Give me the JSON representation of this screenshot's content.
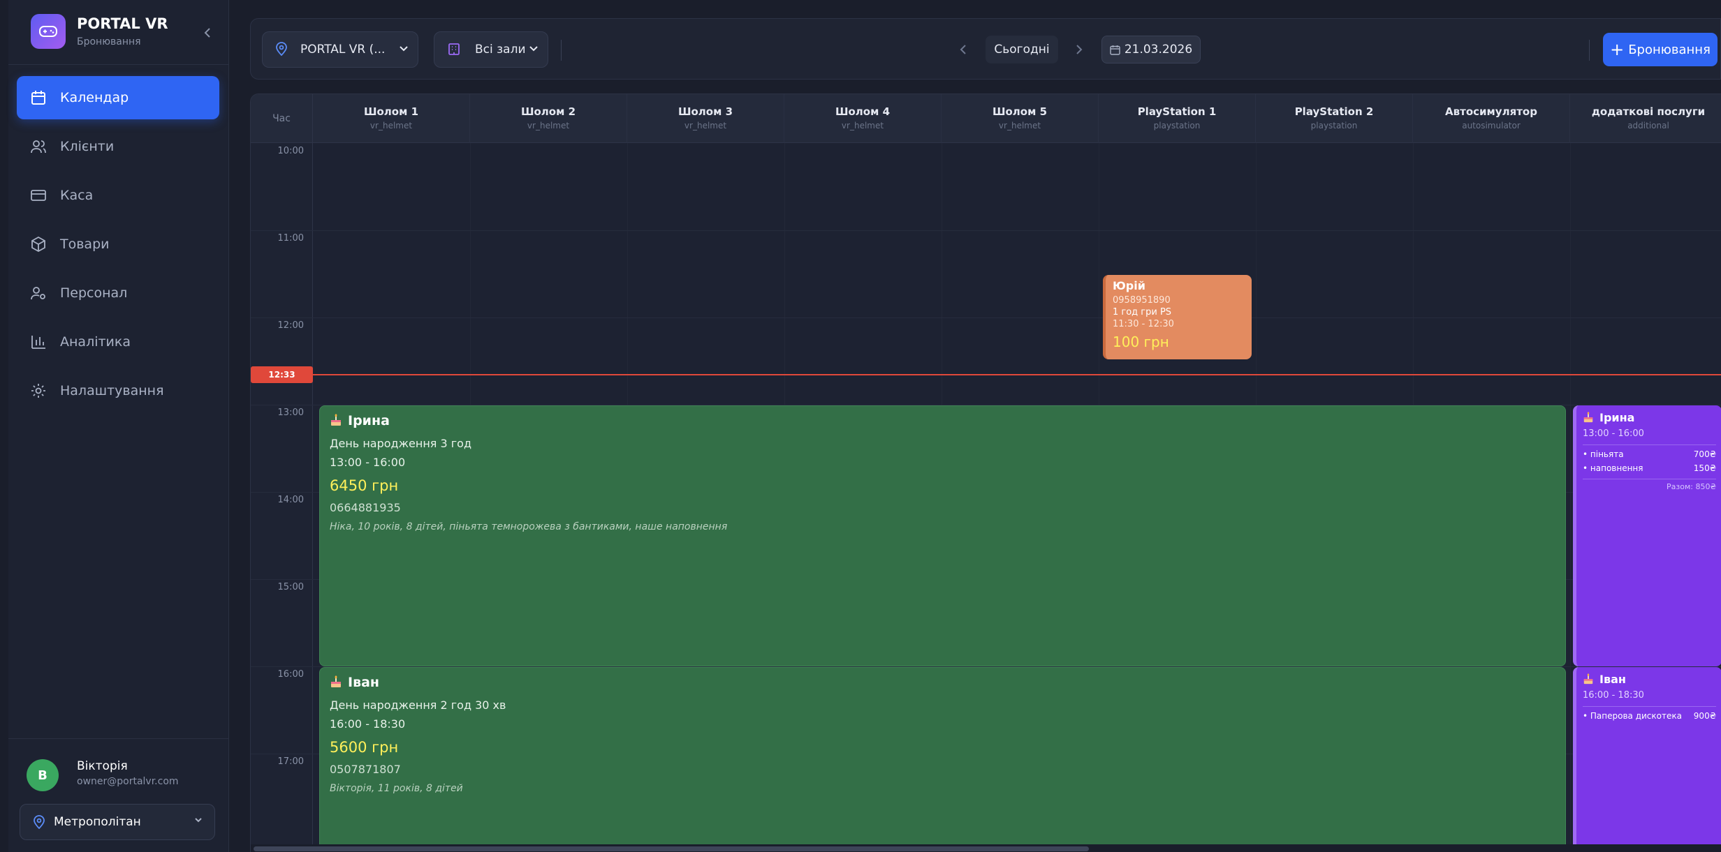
{
  "brand": {
    "title": "PORTAL VR",
    "subtitle": "Бронювання"
  },
  "nav": [
    {
      "label": "Календар",
      "icon": "calendar-icon",
      "active": true
    },
    {
      "label": "Клієнти",
      "icon": "users-icon"
    },
    {
      "label": "Каса",
      "icon": "credit-card-icon"
    },
    {
      "label": "Товари",
      "icon": "box-icon"
    },
    {
      "label": "Персонал",
      "icon": "user-cog-icon"
    },
    {
      "label": "Аналітика",
      "icon": "bar-chart-icon"
    },
    {
      "label": "Налаштування",
      "icon": "gear-icon"
    }
  ],
  "user": {
    "initial": "В",
    "name": "Вікторія",
    "email": "owner@portalvr.com"
  },
  "location_selector": {
    "value": "Метрополітан"
  },
  "toolbar": {
    "venue": "PORTAL VR (...",
    "hall": "Всі зали",
    "today": "Сьогодні",
    "date": "21.03.2026",
    "book_button": "Бронювання"
  },
  "calendar": {
    "time_header": "Час",
    "resources": [
      {
        "name": "Шолом 1",
        "type": "vr_helmet"
      },
      {
        "name": "Шолом 2",
        "type": "vr_helmet"
      },
      {
        "name": "Шолом 3",
        "type": "vr_helmet"
      },
      {
        "name": "Шолом 4",
        "type": "vr_helmet"
      },
      {
        "name": "Шолом 5",
        "type": "vr_helmet"
      },
      {
        "name": "PlayStation 1",
        "type": "playstation"
      },
      {
        "name": "PlayStation 2",
        "type": "playstation"
      },
      {
        "name": "Автосимулятор",
        "type": "autosimulator"
      },
      {
        "name": "додаткові послуги",
        "type": "additional"
      }
    ],
    "times": [
      "10:00",
      "11:00",
      "12:00",
      "13:00",
      "14:00",
      "15:00",
      "16:00",
      "17:00"
    ],
    "now": "12:33",
    "colors": {
      "birthday": "#336f47",
      "playstation": "#e38b60",
      "additional": "#7c37e8",
      "now": "#e0483a",
      "accent": "#2f65f3"
    },
    "events": {
      "yuriy": {
        "name": "Юрій",
        "phone": "0958951890",
        "service": "1 год гри PS",
        "time": "11:30 - 12:30",
        "price": "100 грн"
      },
      "iryna": {
        "name": "Ірина",
        "service": "День народження 3 год",
        "time": "13:00 - 16:00",
        "price": "6450 грн",
        "phone": "0664881935",
        "note": "Ніка, 10 років, 8 дітей, піньята темнорожева з бантиками, наше наповнення"
      },
      "ivan": {
        "name": "Іван",
        "service": "День народження 2 год 30 хв",
        "time": "16:00 - 18:30",
        "price": "5600 грн",
        "phone": "0507871807",
        "note": "Вікторія, 11 років, 8 дітей"
      },
      "iryna_extra": {
        "name": "Ірина",
        "time": "13:00 - 16:00",
        "items": [
          {
            "label": "• піньята",
            "price": "700₴"
          },
          {
            "label": "• наповнення",
            "price": "150₴"
          }
        ],
        "total": "Разом: 850₴"
      },
      "ivan_extra": {
        "name": "Іван",
        "time": "16:00 - 18:30",
        "items": [
          {
            "label": "• Паперова дискотека",
            "price": "900₴"
          }
        ]
      }
    }
  }
}
